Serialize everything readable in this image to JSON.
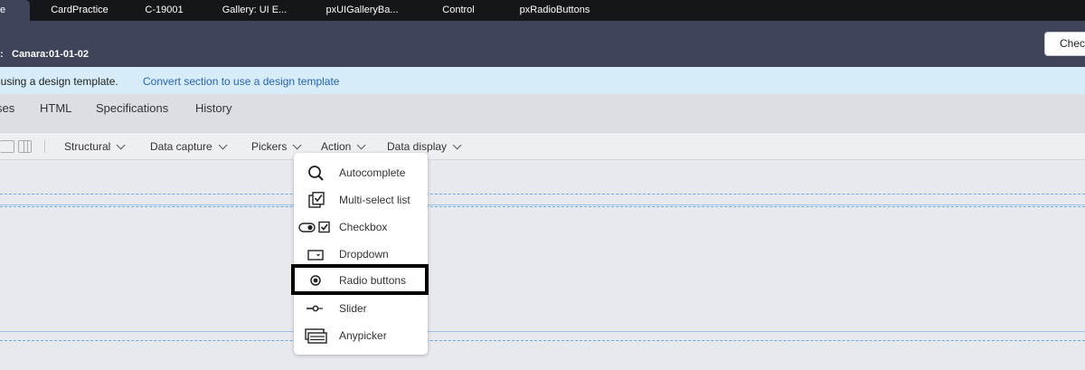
{
  "tabs": [
    {
      "label": "e",
      "active": true
    },
    {
      "label": "CardPractice"
    },
    {
      "label": "C-19001"
    },
    {
      "label": "Gallery: UI E..."
    },
    {
      "label": "pxUIGalleryBa..."
    },
    {
      "label": "Control"
    },
    {
      "label": "pxRadioButtons"
    }
  ],
  "header": {
    "colon": ":",
    "ruleset_label": "Canara:01-01-02",
    "check_button": "Chec"
  },
  "banner": {
    "text": "f using a design template.",
    "link": "Convert section to use a design template"
  },
  "subtabs": [
    "ses",
    "HTML",
    "Specifications",
    "History"
  ],
  "toolbar": {
    "items": [
      "Structural",
      "Data capture",
      "Pickers",
      "Action",
      "Data display"
    ]
  },
  "menu": {
    "items": [
      {
        "label": "Autocomplete",
        "icon": "search-icon"
      },
      {
        "label": "Multi-select list",
        "icon": "multi-select-icon"
      },
      {
        "label": "Checkbox",
        "icon": "checkbox-icon"
      },
      {
        "label": "Dropdown",
        "icon": "dropdown-icon"
      },
      {
        "label": "Radio buttons",
        "icon": "radio-icon",
        "selected": true
      },
      {
        "label": "Slider",
        "icon": "slider-icon"
      },
      {
        "label": "Anypicker",
        "icon": "anypicker-icon"
      }
    ]
  },
  "colors": {
    "tabbar": "#15161a",
    "header": "#40445a",
    "banner": "#d6ecf8",
    "link": "#2a63b5",
    "canvas": "#e8e9ee",
    "dashed_line": "#6aa9e6"
  }
}
